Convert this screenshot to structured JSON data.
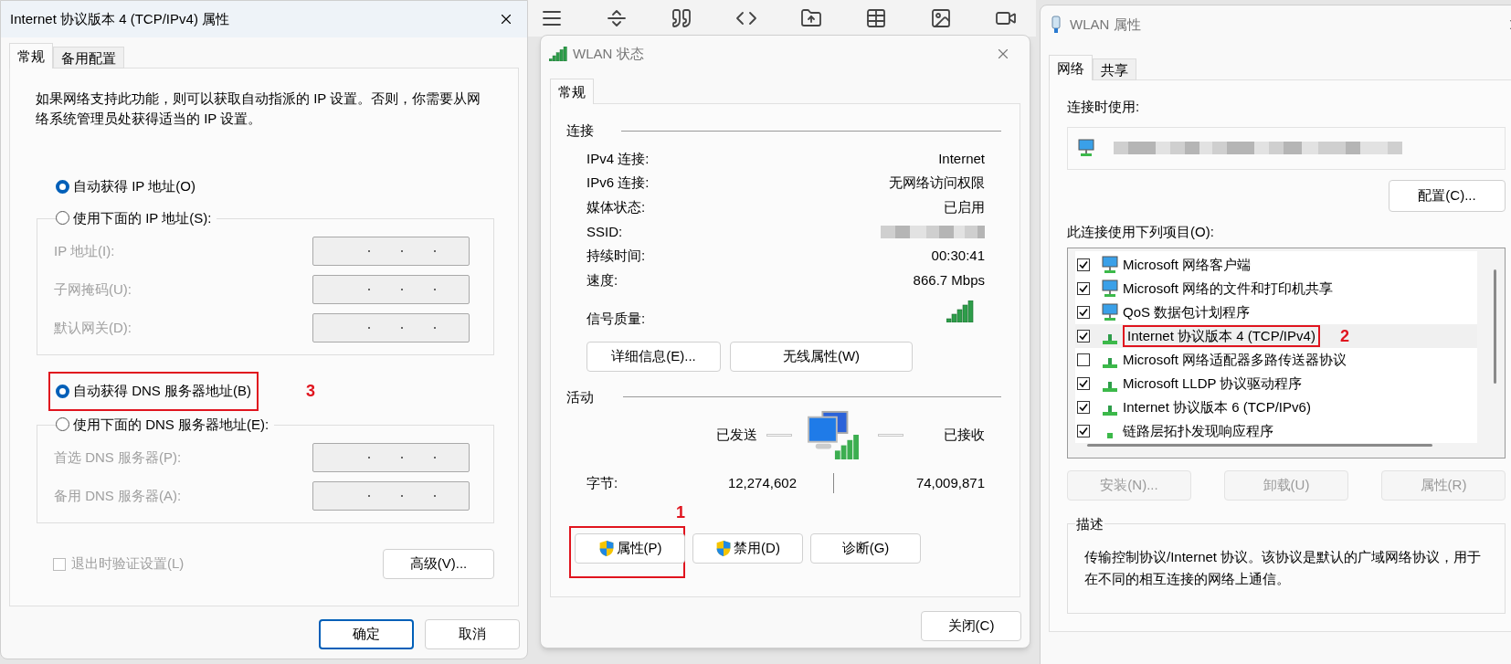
{
  "ipv4_dialog": {
    "title": "Internet 协议版本 4 (TCP/IPv4) 属性",
    "tabs": [
      {
        "label": "常规",
        "selected": true
      },
      {
        "label": "备用配置",
        "selected": false
      }
    ],
    "description": "如果网络支持此功能，则可以获取自动指派的 IP 设置。否则，你需要从网络系统管理员处获得适当的 IP 设置。",
    "ip_options": [
      {
        "label": "自动获得 IP 地址(O)",
        "selected": true,
        "highlighted": false
      },
      {
        "label": "使用下面的 IP 地址(S):",
        "selected": false,
        "highlighted": false
      }
    ],
    "ip_fields": [
      {
        "label": "IP 地址(I):",
        "disabled": true
      },
      {
        "label": "子网掩码(U):",
        "disabled": true
      },
      {
        "label": "默认网关(D):",
        "disabled": true
      }
    ],
    "dns_options": [
      {
        "label": "自动获得 DNS 服务器地址(B)",
        "selected": true,
        "highlighted": true
      },
      {
        "label": "使用下面的 DNS 服务器地址(E):",
        "selected": false,
        "highlighted": false
      }
    ],
    "dns_fields": [
      {
        "label": "首选 DNS 服务器(P):",
        "disabled": true
      },
      {
        "label": "备用 DNS 服务器(A):",
        "disabled": true
      }
    ],
    "annotation": "3",
    "validate": {
      "label": "退出时验证设置(L)",
      "checked": false,
      "disabled": true
    },
    "advanced_button": "高级(V)...",
    "buttons": [
      {
        "label": "确定",
        "default": true
      },
      {
        "label": "取消",
        "default": false
      }
    ]
  },
  "status_dialog": {
    "title": "WLAN 状态",
    "tabs": [
      {
        "label": "常规",
        "selected": true
      }
    ],
    "connection_heading": "连接",
    "rows": [
      {
        "label": "IPv4 连接:",
        "value": "Internet"
      },
      {
        "label": "IPv6 连接:",
        "value": "无网络访问权限"
      },
      {
        "label": "媒体状态:",
        "value": "已启用"
      },
      {
        "label": "SSID:",
        "kind": "blurred"
      },
      {
        "label": "持续时间:",
        "value": "00:30:41"
      },
      {
        "label": "速度:",
        "value": "866.7 Mbps"
      }
    ],
    "signal_label": "信号质量:",
    "info_buttons": [
      "详细信息(E)...",
      "无线属性(W)"
    ],
    "activity_heading": "活动",
    "sent_label": "已发送",
    "received_label": "已接收",
    "bytes_label": "字节:",
    "bytes_sent": "12,274,602",
    "bytes_received": "74,009,871",
    "annotation": "1",
    "action_buttons": [
      {
        "label": "属性(P)",
        "kind": "shield",
        "highlighted": true
      },
      {
        "label": "禁用(D)",
        "kind": "shield",
        "highlighted": false
      },
      {
        "label": "诊断(G)",
        "kind": "plain",
        "highlighted": false
      }
    ],
    "close_button": "关闭(C)"
  },
  "properties_dialog": {
    "title": "WLAN 属性",
    "tabs": [
      {
        "label": "网络",
        "selected": true
      },
      {
        "label": "共享",
        "selected": false
      }
    ],
    "connect_using_label": "连接时使用:",
    "configure_button": "配置(C)...",
    "items_label": "此连接使用下列项目(O):",
    "items": [
      {
        "label": "Microsoft 网络客户端",
        "checked": true,
        "kind": "client",
        "selected": false,
        "highlighted": false
      },
      {
        "label": "Microsoft 网络的文件和打印机共享",
        "checked": true,
        "kind": "client",
        "selected": false,
        "highlighted": false
      },
      {
        "label": "QoS 数据包计划程序",
        "checked": true,
        "kind": "client",
        "selected": false,
        "highlighted": false
      },
      {
        "label": "Internet 协议版本 4 (TCP/IPv4)",
        "checked": true,
        "kind": "protocol",
        "selected": true,
        "highlighted": true
      },
      {
        "label": "Microsoft 网络适配器多路传送器协议",
        "checked": false,
        "kind": "protocol",
        "selected": false,
        "highlighted": false
      },
      {
        "label": "Microsoft LLDP 协议驱动程序",
        "checked": true,
        "kind": "protocol",
        "selected": false,
        "highlighted": false
      },
      {
        "label": "Internet 协议版本 6 (TCP/IPv6)",
        "checked": true,
        "kind": "protocol",
        "selected": false,
        "highlighted": false
      },
      {
        "label": "链路层拓扑发现响应程序",
        "checked": true,
        "kind": "small",
        "selected": false,
        "highlighted": false
      }
    ],
    "annotation": "2",
    "item_buttons": [
      {
        "label": "安装(N)...",
        "disabled": true
      },
      {
        "label": "卸载(U)",
        "disabled": true
      },
      {
        "label": "属性(R)",
        "disabled": true
      }
    ],
    "description_heading": "描述",
    "description": "传输控制协议/Internet 协议。该协议是默认的广域网络协议，用于在不同的相互连接的网络上通信。"
  }
}
